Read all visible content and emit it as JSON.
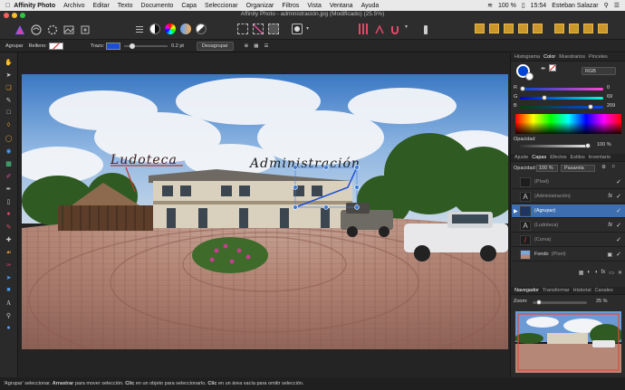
{
  "menubar": {
    "app": "Affinity Photo",
    "items": [
      "Archivo",
      "Editar",
      "Texto",
      "Documento",
      "Capa",
      "Seleccionar",
      "Organizar",
      "Filtros",
      "Vista",
      "Ventana",
      "Ayuda"
    ],
    "battery": "100 %",
    "clock": "15:54",
    "user": "Esteban Salazar"
  },
  "window": {
    "title": "Affinity Photo - administración.jpg (Modificado) (25.5%)"
  },
  "context": {
    "agrupar": "Agrupar",
    "relleno": "Relleno:",
    "trazo": "Trazo:",
    "stroke_width": "0.2 pt",
    "desagrupar": "Desagrupar"
  },
  "canvas": {
    "text1": "Ludoteca",
    "text2": "Administración"
  },
  "color_panel": {
    "tabs": [
      "Histograma",
      "Color",
      "Muestrarios",
      "Pinceles"
    ],
    "active_tab": "Color",
    "mode": "RGB",
    "r_label": "R",
    "g_label": "G",
    "b_label": "B",
    "r": "0",
    "g": "69",
    "b": "209",
    "opacity_label": "Opacidad",
    "opacity_value": "100 %",
    "fill_color": "#0045d1"
  },
  "layers_panel": {
    "tabs": [
      "Ajuste",
      "Capas",
      "Efectos",
      "Estilos",
      "Inventario"
    ],
    "active_tab": "Capas",
    "opacity_label": "Opacidad:",
    "opacity_value": "100 %",
    "blend": "Pasarela",
    "layers": [
      {
        "name": "(Píxel)",
        "icon": "",
        "fx": ""
      },
      {
        "name": "(Administración)",
        "icon": "A",
        "fx": "fx"
      },
      {
        "name": "(Agrupar)",
        "icon": "",
        "fx": ""
      },
      {
        "name": "(Ludoteca)",
        "icon": "A",
        "fx": "fx"
      },
      {
        "name": "(Curva)",
        "icon": "/",
        "fx": ""
      },
      {
        "name": "Fondo",
        "suffix": "(Píxel)",
        "icon": "",
        "fx": ""
      }
    ]
  },
  "navigator": {
    "tabs": [
      "Navegador",
      "Transformar",
      "Historial",
      "Canales"
    ],
    "active_tab": "Navegador",
    "zoom_label": "Zoom:",
    "zoom_value": "25 %"
  },
  "status": {
    "s1": "'Agrupar' seleccionar.",
    "b1": "Arrastrar",
    "s2": "para mover selección.",
    "b2": "Clic",
    "s3": "en un objeto para seleccionarlo.",
    "b3": "Clic",
    "s4": "en un área vacía para omitir selección."
  }
}
